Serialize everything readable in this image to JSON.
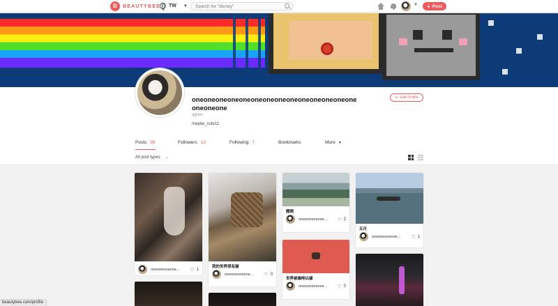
{
  "header": {
    "logo_text": "BEAUTYBEE",
    "region": "TW",
    "search_placeholder": "Search for \"disney\"",
    "post_label": "Post"
  },
  "profile": {
    "username": "oneoneoneoneoneoneoneoneoneoneoneoneoneoneoneoneone",
    "handle": "agnes",
    "bio": "maybe_cute11",
    "edit_label": "Edit Profile"
  },
  "tabs": [
    {
      "label": "Posts",
      "count": "98"
    },
    {
      "label": "Followers",
      "count": "13"
    },
    {
      "label": "Following",
      "count": "7"
    },
    {
      "label": "Bookmarks",
      "count": ""
    },
    {
      "label": "More",
      "count": ""
    }
  ],
  "filter": {
    "label": "All post types"
  },
  "posts": [
    {
      "caption": "",
      "author": "oneoneoneone...",
      "likes": "1"
    },
    {
      "caption": "我的世界很有貓",
      "author": "oneoneoneone...",
      "likes": "0"
    },
    {
      "caption": "耀眼",
      "author": "oneoneoneone...",
      "likes": "2"
    },
    {
      "caption": "五月",
      "author": "oneoneoneone...",
      "likes": "1"
    },
    {
      "caption": "世界被貓咪佔據",
      "author": "oneoneoneone...",
      "likes": "0"
    }
  ],
  "status_url": "beautybee.com/profile",
  "colors": {
    "accent": "#ef5b5b",
    "banner": "#0c3b78"
  }
}
